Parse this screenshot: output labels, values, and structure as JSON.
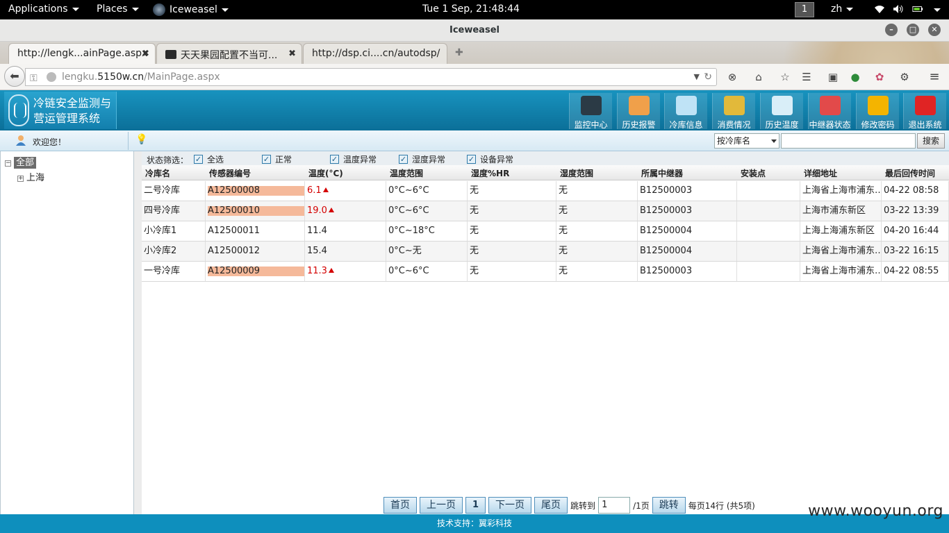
{
  "topbar": {
    "applications": "Applications",
    "places": "Places",
    "app_name": "Iceweasel",
    "clock": "Tue  1 Sep, 21:48:44",
    "workspace": "1",
    "lang": "zh"
  },
  "window": {
    "title": "Iceweasel"
  },
  "tabs": [
    {
      "label": "http://lengk...ainPage.aspx"
    },
    {
      "label": "天天果园配置不当可..."
    },
    {
      "label": "http://dsp.ci....cn/autodsp/"
    }
  ],
  "url": {
    "prefix": "lengku.",
    "host": "5150w.cn",
    "path": "/MainPage.aspx"
  },
  "app": {
    "title_line1": "冷链安全监测与",
    "title_line2": "营运管理系统",
    "nav": [
      {
        "label": "监控中心",
        "icon": "monitor-icon",
        "color": "#2b3a45"
      },
      {
        "label": "历史报警",
        "icon": "alarm-clock-icon",
        "color": "#f0a04a"
      },
      {
        "label": "冷库信息",
        "icon": "chat-bubble-icon",
        "color": "#bfe3f6"
      },
      {
        "label": "消费情况",
        "icon": "coins-icon",
        "color": "#e2b93a"
      },
      {
        "label": "历史温度",
        "icon": "snowflake-icon",
        "color": "#d9eef8"
      },
      {
        "label": "中继器状态",
        "icon": "relay-icon",
        "color": "#e24a4a"
      },
      {
        "label": "修改密码",
        "icon": "gear-icon",
        "color": "#f4b400"
      },
      {
        "label": "退出系统",
        "icon": "power-icon",
        "color": "#e02424"
      }
    ]
  },
  "welcome": {
    "text": "欢迎您！",
    "search_select": "按冷库名",
    "search_button": "搜索"
  },
  "tree": {
    "root": "全部",
    "child": "上海"
  },
  "filters": {
    "label": "状态筛选：",
    "items": [
      "全选",
      "正常",
      "温度异常",
      "湿度异常",
      "设备异常"
    ]
  },
  "grid": {
    "headers": [
      "冷库名",
      "传感器编号",
      "温度(°C)",
      "温度范围",
      "湿度%HR",
      "湿度范围",
      "所属中继器",
      "安装点",
      "详细地址",
      "最后回传时间"
    ],
    "rows": [
      {
        "name": "二号冷库",
        "sensor": "A12500008",
        "temp": "6.1",
        "alarm": true,
        "trange": "0°C~6°C",
        "hum": "无",
        "hrange": "无",
        "relay": "B12500003",
        "install": "",
        "addr": "上海省上海市浦东…",
        "time": "04-22 08:58"
      },
      {
        "name": "四号冷库",
        "sensor": "A12500010",
        "temp": "19.0",
        "alarm": true,
        "trange": "0°C~6°C",
        "hum": "无",
        "hrange": "无",
        "relay": "B12500003",
        "install": "",
        "addr": "上海市浦东新区",
        "time": "03-22 13:39"
      },
      {
        "name": "小冷库1",
        "sensor": "A12500011",
        "temp": "11.4",
        "alarm": false,
        "trange": "0°C~18°C",
        "hum": "无",
        "hrange": "无",
        "relay": "B12500004",
        "install": "",
        "addr": "上海上海浦东新区",
        "time": "04-20 16:44"
      },
      {
        "name": "小冷库2",
        "sensor": "A12500012",
        "temp": "15.4",
        "alarm": false,
        "trange": "0°C~无",
        "hum": "无",
        "hrange": "无",
        "relay": "B12500004",
        "install": "",
        "addr": "上海省上海市浦东…",
        "time": "03-22 16:15"
      },
      {
        "name": "一号冷库",
        "sensor": "A12500009",
        "temp": "11.3",
        "alarm": true,
        "trange": "0°C~6°C",
        "hum": "无",
        "hrange": "无",
        "relay": "B12500003",
        "install": "",
        "addr": "上海省上海市浦东…",
        "time": "04-22 08:55"
      }
    ]
  },
  "pager": {
    "first": "首页",
    "prev": "上一页",
    "current": "1",
    "next": "下一页",
    "last": "尾页",
    "goto_label": "跳转到",
    "goto_value": "1",
    "total_pages": "/1页",
    "goto_button": "跳转",
    "summary": "每页14行 (共5项)"
  },
  "footer": {
    "text": "技术支持：翼彩科技"
  },
  "watermark": "www.wooyun.org",
  "colors": {
    "header": "#1893bf",
    "alarm": "#d40000",
    "sensor_highlight": "#f5b99a"
  }
}
